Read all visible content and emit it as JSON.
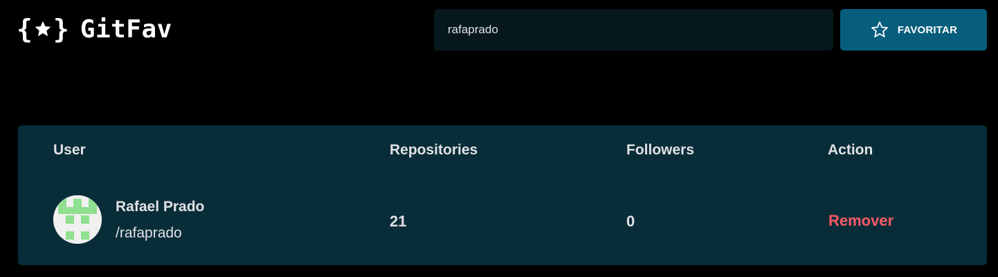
{
  "app": {
    "logo_open_brace": "{",
    "logo_close_brace": "}",
    "name": "GitFav"
  },
  "search": {
    "value": "rafaprado"
  },
  "favorite_button": {
    "label": "FAVORITAR",
    "icon": "star-outline-icon"
  },
  "table": {
    "headers": {
      "user": "User",
      "repositories": "Repositories",
      "followers": "Followers",
      "action": "Action"
    },
    "rows": [
      {
        "name": "Rafael Prado",
        "login": "/rafaprado",
        "repositories": "21",
        "followers": "0",
        "action": "Remover",
        "avatar": "identicon"
      }
    ]
  },
  "colors": {
    "background": "#000000",
    "search_bg": "#06181C",
    "button_bg": "#065E7C",
    "table_bg": "#092D38",
    "remove_text": "#F75A68",
    "identicon": "#8FE08F"
  }
}
